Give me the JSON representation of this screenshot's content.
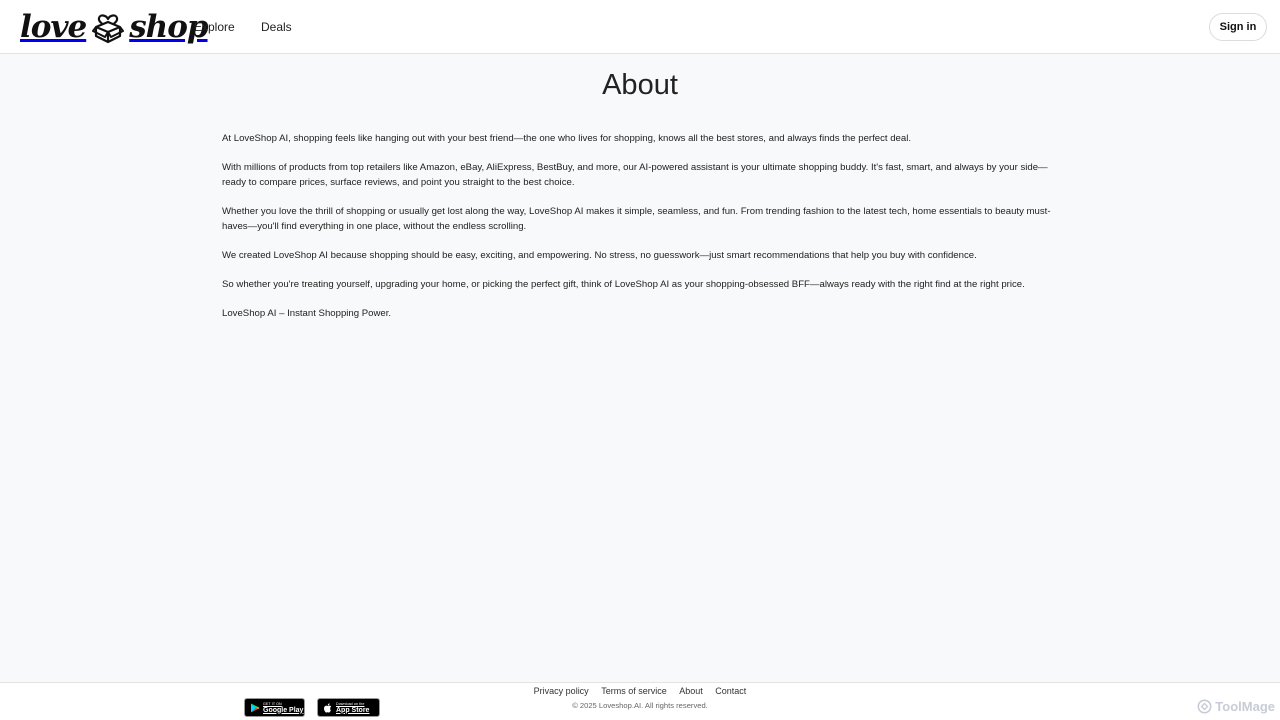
{
  "header": {
    "logo": {
      "word_left": "love",
      "word_right": "shop"
    },
    "nav": [
      {
        "label": "Explore"
      },
      {
        "label": "Deals"
      }
    ],
    "sign_in_label": "Sign in"
  },
  "main": {
    "title": "About",
    "paragraphs": [
      "At LoveShop AI, shopping feels like hanging out with your best friend—the one who lives for shopping, knows all the best stores, and always finds the perfect deal.",
      "With millions of products from top retailers like Amazon, eBay, AliExpress, BestBuy, and more, our AI-powered assistant is your ultimate shopping buddy. It's fast, smart, and always by your side—ready to compare prices, surface reviews, and point you straight to the best choice.",
      "Whether you love the thrill of shopping or usually get lost along the way, LoveShop AI makes it simple, seamless, and fun. From trending fashion to the latest tech, home essentials to beauty must-haves—you'll find everything in one place, without the endless scrolling.",
      "We created LoveShop AI because shopping should be easy, exciting, and empowering. No stress, no guesswork—just smart recommendations that help you buy with confidence.",
      "So whether you're treating yourself, upgrading your home, or picking the perfect gift, think of LoveShop AI as your shopping-obsessed BFF—always ready with the right find at the right price.",
      "LoveShop AI – Instant Shopping Power."
    ]
  },
  "footer": {
    "badges": {
      "google": {
        "small": "GET IT ON",
        "big": "Google Play"
      },
      "apple": {
        "small": "Download on the",
        "big": "App Store"
      }
    },
    "links": [
      {
        "label": "Privacy policy"
      },
      {
        "label": "Terms of service"
      },
      {
        "label": "About"
      },
      {
        "label": "Contact"
      }
    ],
    "copyright": "© 2025 Loveshop.AI. All rights reserved."
  },
  "watermark": {
    "label": "ToolMage"
  },
  "icons": {
    "logo": "heart-box-icon",
    "google_play": "google-play-icon",
    "apple": "apple-icon",
    "watermark": "toolmage-icon"
  },
  "colors": {
    "page_background": "#f8f9fa",
    "header_background": "#ffffff",
    "text": "#222222",
    "border": "#e3e3e3",
    "badge_background": "#000000"
  }
}
